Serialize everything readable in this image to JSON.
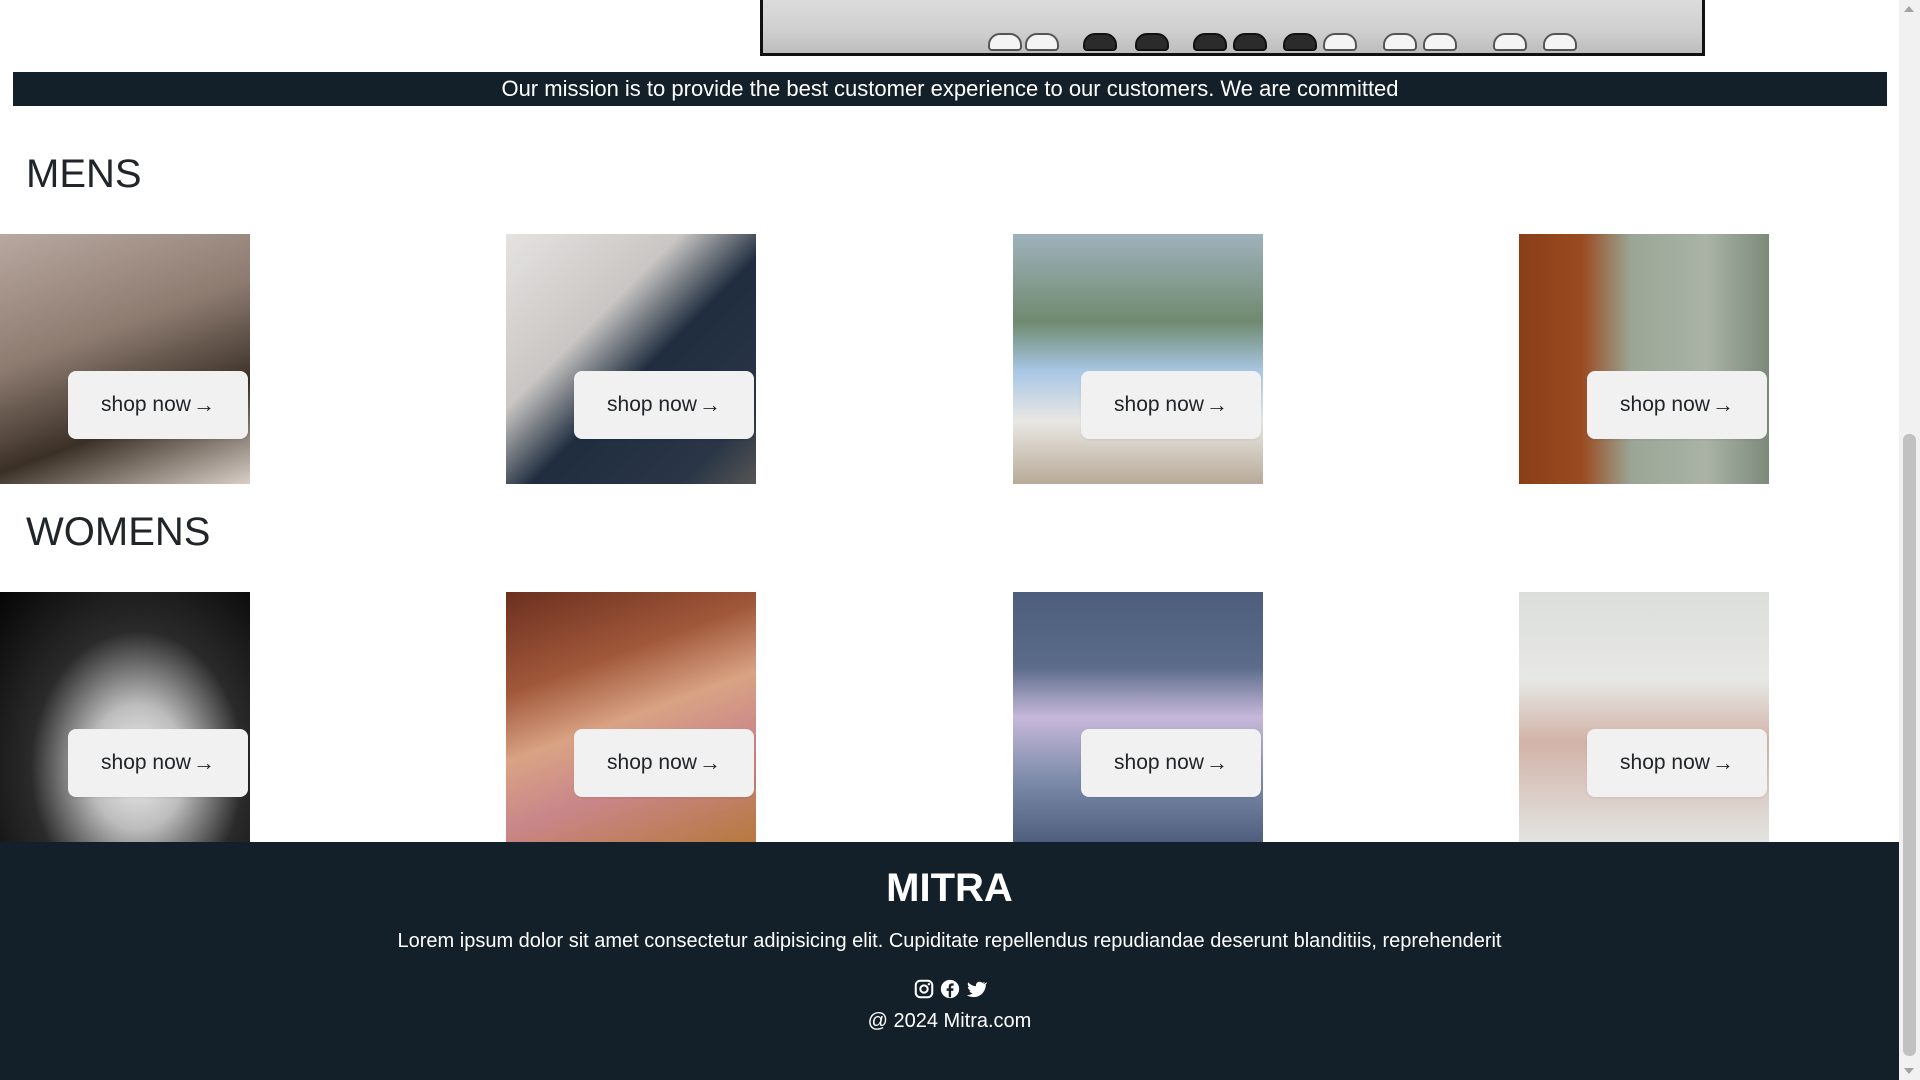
{
  "mission_text": "Our mission is to provide the best customer experience to our customers. We are committed",
  "sections": {
    "mens": {
      "title": "MENS",
      "cards": [
        {
          "button": "shop now"
        },
        {
          "button": "shop now"
        },
        {
          "button": "shop now"
        },
        {
          "button": "shop now"
        }
      ]
    },
    "womens": {
      "title": "WOMENS",
      "cards": [
        {
          "button": "shop now"
        },
        {
          "button": "shop now"
        },
        {
          "button": "shop now"
        },
        {
          "button": "shop now"
        }
      ]
    }
  },
  "footer": {
    "brand": "MITRA",
    "text": "Lorem ipsum dolor sit amet consectetur adipisicing elit. Cupiditate repellendus repudiandae deserunt blanditiis, reprehenderit",
    "social_icons": [
      "instagram-icon",
      "facebook-icon",
      "twitter-icon"
    ],
    "copyright": "@ 2024 Mitra.com"
  },
  "colors": {
    "dark": "#132029",
    "button_bg": "#f1f1f1"
  }
}
